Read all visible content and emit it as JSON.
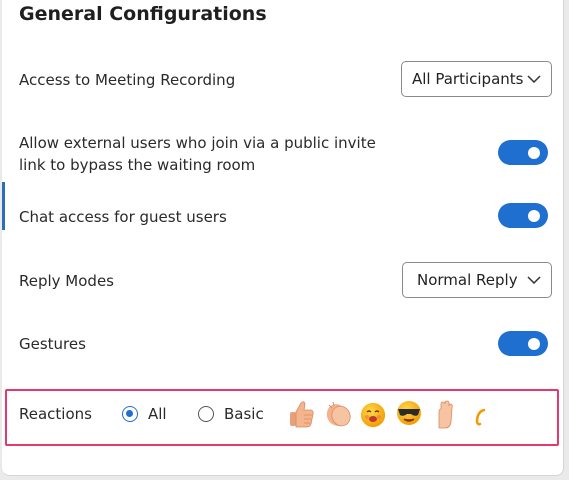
{
  "panel": {
    "title": "General Configurations"
  },
  "settings": {
    "recording": {
      "label": "Access to Meeting Recording",
      "value": "All Participants"
    },
    "external": {
      "label_line1": "Allow external users who join via a public invite",
      "label_line2": "link to bypass the waiting room",
      "enabled": true
    },
    "guest_chat": {
      "label": "Chat access for guest users",
      "enabled": true
    },
    "reply_modes": {
      "label": "Reply Modes",
      "value": "Normal Reply"
    },
    "gestures": {
      "label": "Gestures",
      "enabled": true
    },
    "reactions": {
      "label": "Reactions",
      "options": [
        "All",
        "Basic"
      ],
      "selected": "All",
      "emojis": [
        "thumbs-up",
        "clapping-hands",
        "laughing-face",
        "sunglasses-face",
        "raised-hand",
        "partial-emoji"
      ]
    }
  },
  "colors": {
    "accent": "#1f6fd1",
    "highlight_border": "#e5396b"
  }
}
